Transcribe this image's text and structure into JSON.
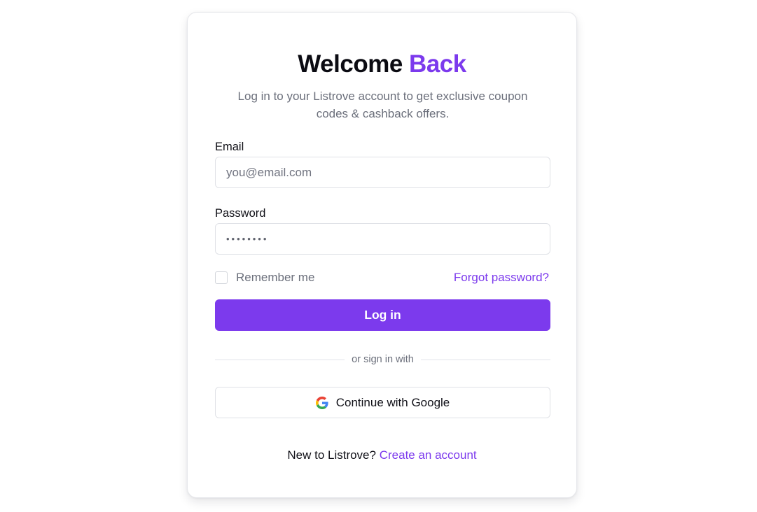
{
  "colors": {
    "accent": "#7c3aed",
    "text": "#111118",
    "muted": "#6b6f7b",
    "border": "#dfe1e6"
  },
  "header": {
    "title_main": "Welcome",
    "title_accent": "Back",
    "subtitle": "Log in to your Listrove account to get exclusive coupon codes & cashback offers."
  },
  "form": {
    "email_label": "Email",
    "email_placeholder": "you@email.com",
    "password_label": "Password",
    "password_value": "••••••••",
    "remember_label": "Remember me",
    "remember_checked": false,
    "forgot_label": "Forgot password?",
    "submit_label": "Log in"
  },
  "divider": {
    "text": "or sign in with"
  },
  "social": {
    "google_icon": "google-icon",
    "google_label": "Continue with Google"
  },
  "footer": {
    "prompt": "New to Listrove?",
    "link_label": "Create an account"
  }
}
